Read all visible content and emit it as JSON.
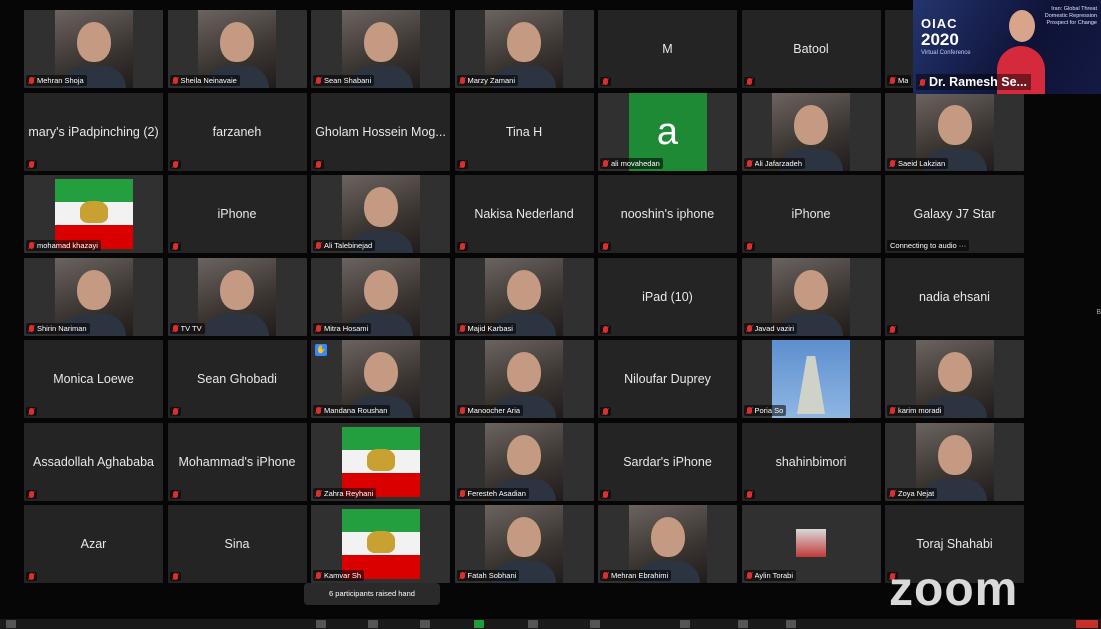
{
  "app": "Zoom",
  "spotlight": {
    "conference_logo": "OIAC",
    "conference_year": "2020",
    "conference_sub": "Virtual Conference",
    "banner_text": "Iran: Global Threat Domestic Repression Prospect for Change",
    "speaker_name": "Dr. Ramesh Se..."
  },
  "tiles": [
    {
      "name": "Mehran Shoja",
      "kind": "video"
    },
    {
      "name": "Sheila Neinavaie",
      "kind": "video"
    },
    {
      "name": "Sean Shabani",
      "kind": "video"
    },
    {
      "name": "Marzy Zamani",
      "kind": "video"
    },
    {
      "name": "M",
      "kind": "text"
    },
    {
      "name": "Batool",
      "kind": "text"
    },
    {
      "name": "Ma",
      "kind": "partial"
    },
    {
      "name": "mary's iPadpinching (2)",
      "kind": "text"
    },
    {
      "name": "farzaneh",
      "kind": "text"
    },
    {
      "name": "Gholam Hossein Mog...",
      "kind": "text"
    },
    {
      "name": "Tina H",
      "kind": "text"
    },
    {
      "name": "ali movahedan",
      "kind": "avatar",
      "avatar_letter": "a"
    },
    {
      "name": "Ali Jafarzadeh",
      "kind": "video"
    },
    {
      "name": "Saeid Lakzian",
      "kind": "video"
    },
    {
      "name": "mohamad khazayi",
      "kind": "flag"
    },
    {
      "name": "iPhone",
      "kind": "text"
    },
    {
      "name": "Ali Talebinejad",
      "kind": "video"
    },
    {
      "name": "Nakisa Nederland",
      "kind": "text"
    },
    {
      "name": "nooshin's iphone",
      "kind": "text"
    },
    {
      "name": "iPhone",
      "kind": "text"
    },
    {
      "name": "Galaxy J7 Star",
      "kind": "text",
      "status": "Connecting to audio ···"
    },
    {
      "name": "Shirin Nariman",
      "kind": "video"
    },
    {
      "name": "TV TV",
      "kind": "video"
    },
    {
      "name": "Mitra Hosami",
      "kind": "video"
    },
    {
      "name": "Majid Karbasi",
      "kind": "video"
    },
    {
      "name": "iPad (10)",
      "kind": "text"
    },
    {
      "name": "Javad vaziri",
      "kind": "video"
    },
    {
      "name": "nadia ehsani",
      "kind": "text"
    },
    {
      "name": "Monica Loewe",
      "kind": "text"
    },
    {
      "name": "Sean Ghobadi",
      "kind": "text"
    },
    {
      "name": "Mandana Roushan",
      "kind": "video",
      "hand_raised": true
    },
    {
      "name": "Manoocher Aria",
      "kind": "video"
    },
    {
      "name": "Niloufar Duprey",
      "kind": "text"
    },
    {
      "name": "Poria So",
      "kind": "tower"
    },
    {
      "name": "karim moradi",
      "kind": "video"
    },
    {
      "name": "Assadollah Aghababa",
      "kind": "text"
    },
    {
      "name": "Mohammad's iPhone",
      "kind": "text"
    },
    {
      "name": "Zahra Reyhani",
      "kind": "flag"
    },
    {
      "name": "Feresteh Asadian",
      "kind": "video"
    },
    {
      "name": "Sardar's iPhone",
      "kind": "text"
    },
    {
      "name": "shahinbimori",
      "kind": "text"
    },
    {
      "name": "Zoya Nejat",
      "kind": "video"
    },
    {
      "name": "Azar",
      "kind": "text"
    },
    {
      "name": "Sina",
      "kind": "text"
    },
    {
      "name": "Kamvar Sh",
      "kind": "flag"
    },
    {
      "name": "Fatah Sobhani",
      "kind": "video"
    },
    {
      "name": "Mehran Ebrahimi",
      "kind": "video"
    },
    {
      "name": "Aylin Torabi",
      "kind": "small"
    },
    {
      "name": "Toraj Shahabi",
      "kind": "text"
    }
  ],
  "raised_hands_notice": "6 participants raised hand",
  "watermark": "zoom",
  "edge_text": "B"
}
